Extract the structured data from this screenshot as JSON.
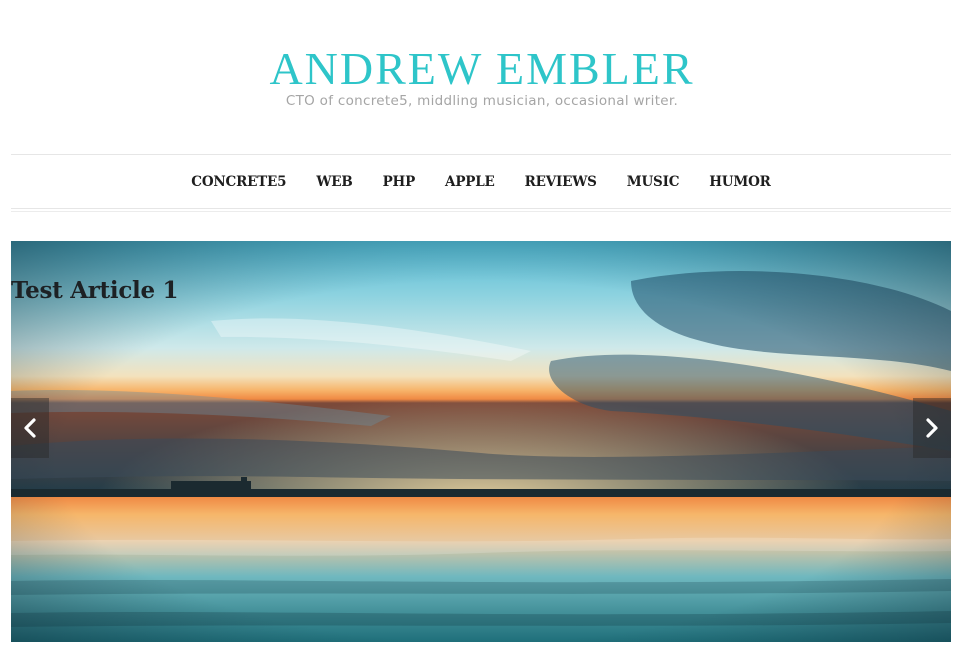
{
  "header": {
    "title": "ANDREW EMBLER",
    "tagline": "CTO of concrete5, middling musician, occasional writer."
  },
  "nav": {
    "items": [
      {
        "label": "CONCRETE5"
      },
      {
        "label": "WEB"
      },
      {
        "label": "PHP"
      },
      {
        "label": "APPLE"
      },
      {
        "label": "REVIEWS"
      },
      {
        "label": "MUSIC"
      },
      {
        "label": "HUMOR"
      }
    ]
  },
  "slider": {
    "caption": "Test Article 1",
    "prev_icon": "chevron-left-icon",
    "next_icon": "chevron-right-icon"
  },
  "colors": {
    "title": "#2ec5c9",
    "tagline": "#a5a5a5",
    "nav_text": "#1e1e1e",
    "rule": "#e6e6e6"
  }
}
